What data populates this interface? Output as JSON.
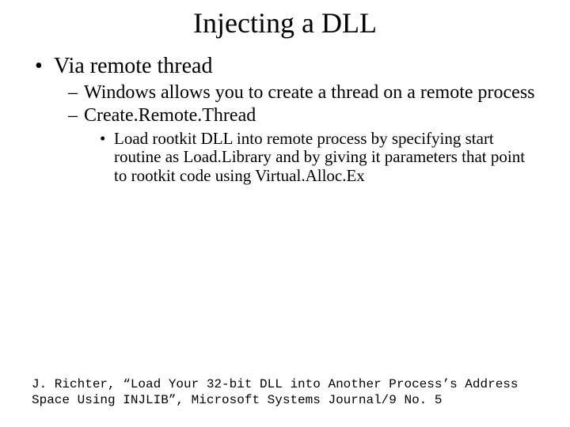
{
  "title": "Injecting a DLL",
  "bullets": {
    "l1_0": "Via remote thread",
    "l2_0": "Windows allows you to create a thread on a remote process",
    "l2_1": "Create.Remote.Thread",
    "l3_0": "Load rootkit DLL into remote process by specifying start routine as Load.Library and by giving it parameters that point to rootkit code using Virtual.Alloc.Ex"
  },
  "footer": "J. Richter, “Load Your 32-bit DLL into Another Process’s Address Space Using INJLIB”, Microsoft Systems Journal/9 No. 5"
}
